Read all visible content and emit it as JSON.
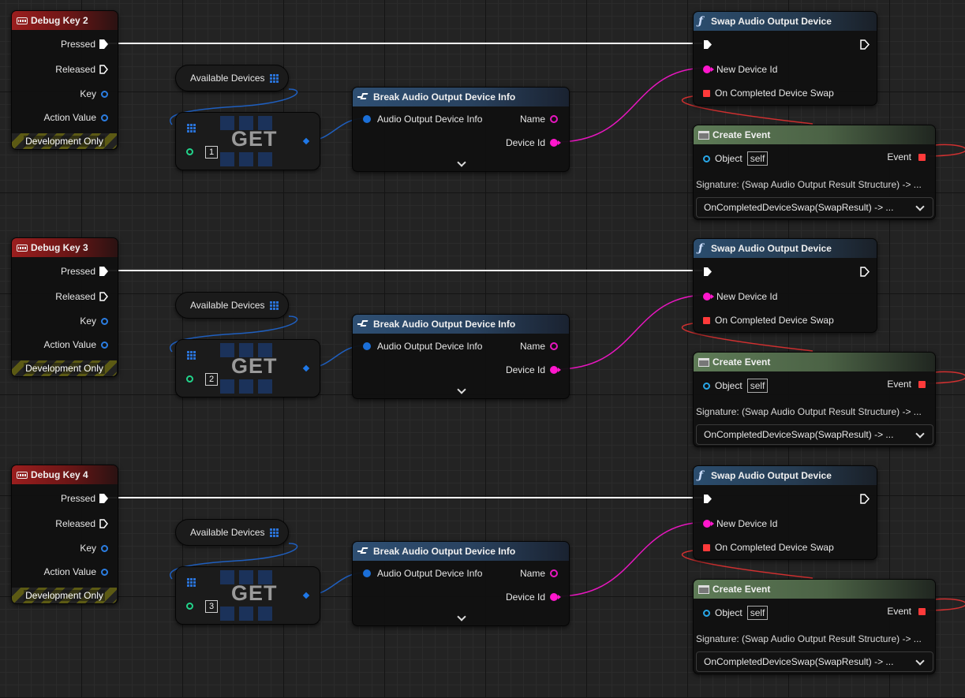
{
  "groups": [
    {
      "event": {
        "title": "Debug Key 2",
        "pins": [
          "Pressed",
          "Released",
          "Key",
          "Action Value"
        ],
        "footer": "Development Only"
      },
      "array_var": "Available Devices",
      "get": {
        "label": "GET",
        "index": "1"
      },
      "break_node": {
        "title": "Break Audio Output Device Info",
        "input": "Audio Output Device Info",
        "out_name": "Name",
        "out_id": "Device Id"
      },
      "swap_node": {
        "title": "Swap Audio Output Device",
        "pin_id": "New Device Id",
        "pin_done": "On Completed Device Swap"
      },
      "create_node": {
        "title": "Create Event",
        "object_label": "Object",
        "object_value": "self",
        "event_label": "Event",
        "signature": "Signature: (Swap Audio Output Result Structure) -> ...",
        "function": "OnCompletedDeviceSwap(SwapResult) -> ..."
      }
    },
    {
      "event": {
        "title": "Debug Key 3",
        "pins": [
          "Pressed",
          "Released",
          "Key",
          "Action Value"
        ],
        "footer": "Development Only"
      },
      "array_var": "Available Devices",
      "get": {
        "label": "GET",
        "index": "2"
      },
      "break_node": {
        "title": "Break Audio Output Device Info",
        "input": "Audio Output Device Info",
        "out_name": "Name",
        "out_id": "Device Id"
      },
      "swap_node": {
        "title": "Swap Audio Output Device",
        "pin_id": "New Device Id",
        "pin_done": "On Completed Device Swap"
      },
      "create_node": {
        "title": "Create Event",
        "object_label": "Object",
        "object_value": "self",
        "event_label": "Event",
        "signature": "Signature: (Swap Audio Output Result Structure) -> ...",
        "function": "OnCompletedDeviceSwap(SwapResult) -> ..."
      }
    },
    {
      "event": {
        "title": "Debug Key 4",
        "pins": [
          "Pressed",
          "Released",
          "Key",
          "Action Value"
        ],
        "footer": "Development Only"
      },
      "array_var": "Available Devices",
      "get": {
        "label": "GET",
        "index": "3"
      },
      "break_node": {
        "title": "Break Audio Output Device Info",
        "input": "Audio Output Device Info",
        "out_name": "Name",
        "out_id": "Device Id"
      },
      "swap_node": {
        "title": "Swap Audio Output Device",
        "pin_id": "New Device Id",
        "pin_done": "On Completed Device Swap"
      },
      "create_node": {
        "title": "Create Event",
        "object_label": "Object",
        "object_value": "self",
        "event_label": "Event",
        "signature": "Signature: (Swap Audio Output Result Structure) -> ...",
        "function": "OnCompletedDeviceSwap(SwapResult) -> ..."
      }
    }
  ],
  "icons": {
    "event_header": "keyboard-icon",
    "function_header": "function-icon",
    "create_header": "window-icon",
    "break_header": "split-icon",
    "array_pin": "array-grid-icon"
  },
  "colors": {
    "exec_wire": "#ffffff",
    "device_id_wire": "#e916c0",
    "struct_wire": "#1f5fbf",
    "event_wire": "#d03030",
    "event_header": "#9b1e1e",
    "function_header": "#2b4d6e",
    "create_header": "#5e7b57"
  }
}
